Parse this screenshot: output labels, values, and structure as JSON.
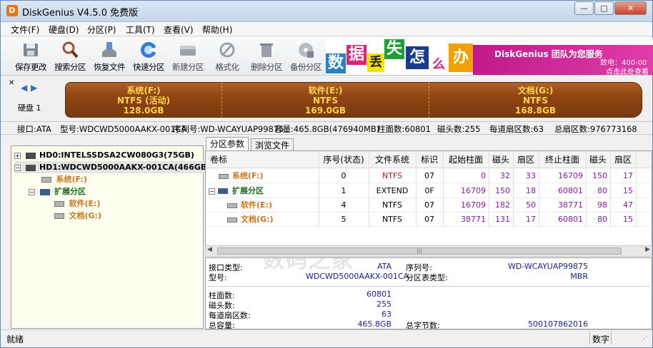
{
  "window": {
    "title": "DiskGenius V4.5.0 免费版",
    "icon_letter": "D"
  },
  "window_controls": {
    "minimize": "—",
    "maximize": "□",
    "close": "✕"
  },
  "menu": [
    "文件(F)",
    "硬盘(D)",
    "分区(P)",
    "工具(T)",
    "查看(V)",
    "帮助(H)"
  ],
  "toolbar": [
    {
      "label": "保存更改",
      "icon": "save-disk-icon"
    },
    {
      "label": "搜索分区",
      "icon": "magnifier-icon"
    },
    {
      "label": "恢复文件",
      "icon": "recover-file-icon"
    },
    {
      "label": "快速分区",
      "icon": "quick-partition-icon"
    },
    {
      "label": "新建分区",
      "icon": "new-partition-icon"
    },
    {
      "label": "格式化",
      "icon": "format-icon"
    },
    {
      "label": "删除分区",
      "icon": "trash-icon"
    },
    {
      "label": "备份分区",
      "icon": "backup-icon"
    }
  ],
  "banner": {
    "chars": [
      "数",
      "据",
      "丢",
      "失",
      "怎",
      "么",
      "办"
    ],
    "slogan": "DiskGenius 团队为您服务",
    "phone": "致电：400-00",
    "link": "点击此处查看"
  },
  "disk_nav": {
    "prev": "◀",
    "next": "▶",
    "label": "硬盘 1"
  },
  "disk_map": [
    {
      "name": "系统(F:)",
      "fs": "NTFS (活动)",
      "size": "128.0GB"
    },
    {
      "name": "软件(E:)",
      "fs": "NTFS",
      "size": "169.0GB"
    },
    {
      "name": "文档(G:)",
      "fs": "NTFS",
      "size": "168.8GB"
    }
  ],
  "disk_info": {
    "iface": "接口:ATA",
    "model": "型号:WDCWD5000AAKX-001CA",
    "serial": "序列号:WD-WCAYUAP99875",
    "capacity": "容量:465.8GB(476940MB)",
    "cylinders": "柱面数:60801",
    "heads": "磁头数:255",
    "sectors": "每道扇区数:63",
    "total_sectors": "总扇区数:976773168"
  },
  "tree": [
    {
      "label": "HD0:INTELSSDSA2CW080G3(75GB)",
      "level": 0
    },
    {
      "label": "HD1:WDCWD5000AAKX-001CA(466GB)",
      "level": 0
    },
    {
      "label": "系统(F:)",
      "level": 1
    },
    {
      "label": "扩展分区",
      "level": 1
    },
    {
      "label": "软件(E:)",
      "level": 2
    },
    {
      "label": "文档(G:)",
      "level": 2
    }
  ],
  "tabs": [
    "分区参数",
    "浏览文件"
  ],
  "grid": {
    "headers": [
      "卷标",
      "序号(状态)",
      "文件系统",
      "标识",
      "起始柱面",
      "磁头",
      "扇区",
      "终止柱面",
      "磁头",
      "扇区"
    ],
    "rows": [
      {
        "label": "系统(F:)",
        "seq": "0",
        "fs": "NTFS",
        "id": "07",
        "sc": "0",
        "sh": "32",
        "ss": "33",
        "ec": "16709",
        "eh": "150",
        "es": "17"
      },
      {
        "label": "扩展分区",
        "seq": "1",
        "fs": "EXTEND",
        "id": "0F",
        "sc": "16709",
        "sh": "150",
        "ss": "18",
        "ec": "60801",
        "eh": "80",
        "es": "15"
      },
      {
        "label": "软件(E:)",
        "seq": "4",
        "fs": "NTFS",
        "id": "07",
        "sc": "16709",
        "sh": "182",
        "ss": "50",
        "ec": "38771",
        "eh": "98",
        "es": "47"
      },
      {
        "label": "文档(G:)",
        "seq": "5",
        "fs": "NTFS",
        "id": "07",
        "sc": "38771",
        "sh": "131",
        "ss": "17",
        "ec": "60801",
        "eh": "80",
        "es": "15"
      }
    ]
  },
  "details": {
    "iface_label": "接口类型:",
    "iface_value": "ATA",
    "serial_label": "序列号:",
    "serial_value": "WD-WCAYUAP99875",
    "model_label": "型号:",
    "model_value": "WDCWD5000AAKX-001CA",
    "ptype_label": "分区表类型:",
    "ptype_value": "MBR",
    "cyl_label": "柱面数:",
    "cyl_value": "60801",
    "heads_label": "磁头数:",
    "heads_value": "255",
    "spt_label": "每道扇区数:",
    "spt_value": "63",
    "cap_label": "总容量:",
    "cap_value": "465.8GB",
    "bytes_label": "总字节数:",
    "bytes_value": "500107862016"
  },
  "watermark": "数码之家",
  "status": {
    "left": "就绪",
    "right": "数字"
  },
  "colors": {
    "partition_gold": "#ffd44a",
    "partition_brown": "#8f4512",
    "tree_label_active": "#c8781e",
    "value_blue": "#1a1aa8"
  }
}
